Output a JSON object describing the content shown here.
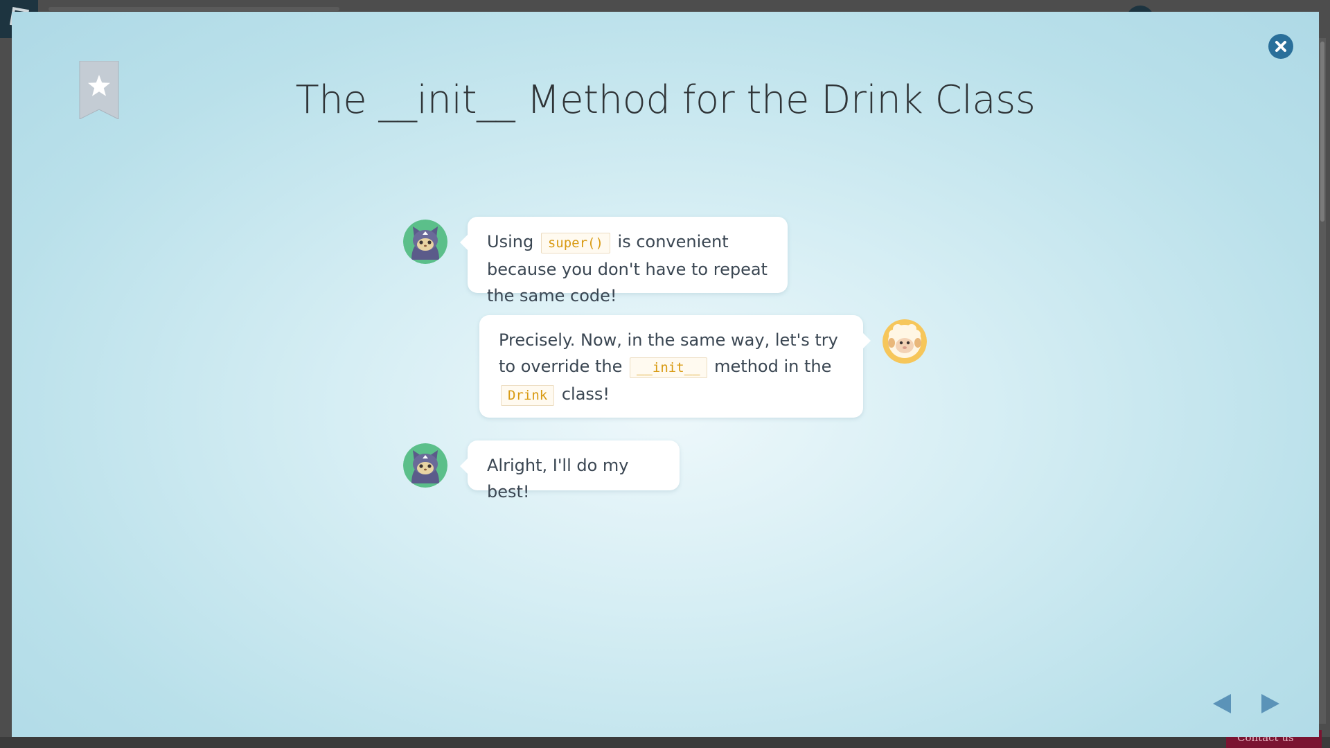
{
  "lesson": {
    "title": "The __init__ Method for the Drink Class"
  },
  "messages": [
    {
      "speaker": "cat",
      "side": "left",
      "parts": [
        {
          "text": "Using "
        },
        {
          "code": "super()"
        },
        {
          "text": " is convenient because you don't have to repeat the same code!"
        }
      ]
    },
    {
      "speaker": "sheep",
      "side": "right",
      "parts": [
        {
          "text": "Precisely. Now, in the same way, let's try to override the "
        },
        {
          "code": "__init__"
        },
        {
          "text": " method in the "
        },
        {
          "code": "Drink"
        },
        {
          "text": " class!"
        }
      ]
    },
    {
      "speaker": "cat",
      "side": "left",
      "parts": [
        {
          "text": "Alright, I'll do my best!"
        }
      ]
    }
  ],
  "controls": {
    "bookmark_icon": "bookmark-star-icon",
    "close_icon": "close-icon",
    "prev_icon": "triangle-left-icon",
    "next_icon": "triangle-right-icon"
  },
  "background": {
    "contact_label": "Contact us"
  },
  "colors": {
    "accent": "#2a6f9a",
    "code_text": "#d89a12",
    "nav_arrow": "#5b93b8",
    "bookmark": "#c4ccd4"
  }
}
